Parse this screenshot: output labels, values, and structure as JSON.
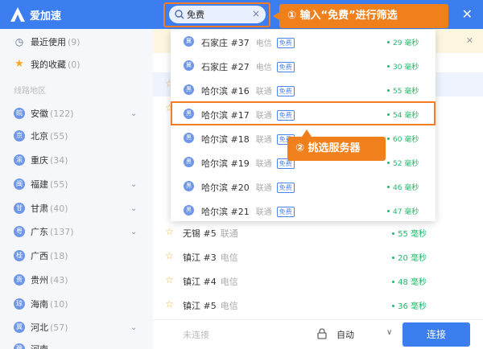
{
  "app": {
    "title": "爱加速"
  },
  "search": {
    "value": "免费",
    "clear": "×"
  },
  "window": {
    "close": "✕"
  },
  "sidebar": {
    "recent": {
      "label": "最近使用",
      "count": "(9)"
    },
    "favorites": {
      "label": "我的收藏",
      "count": "(0)"
    },
    "section_title": "线路地区",
    "regions": [
      {
        "icon": "皖",
        "label": "安徽",
        "count": "(122)",
        "expandable": true
      },
      {
        "icon": "京",
        "label": "北京",
        "count": "(55)",
        "expandable": false
      },
      {
        "icon": "渝",
        "label": "重庆",
        "count": "(34)",
        "expandable": false
      },
      {
        "icon": "闽",
        "label": "福建",
        "count": "(55)",
        "expandable": true
      },
      {
        "icon": "甘",
        "label": "甘肃",
        "count": "(40)",
        "expandable": true
      },
      {
        "icon": "粤",
        "label": "广东",
        "count": "(137)",
        "expandable": true
      },
      {
        "icon": "桂",
        "label": "广西",
        "count": "(18)",
        "expandable": false
      },
      {
        "icon": "贵",
        "label": "贵州",
        "count": "(43)",
        "expandable": false
      },
      {
        "icon": "琼",
        "label": "海南",
        "count": "(10)",
        "expandable": false
      },
      {
        "icon": "冀",
        "label": "河北",
        "count": "(57)",
        "expandable": true
      },
      {
        "icon": "豫",
        "label": "河南",
        "count": "",
        "expandable": false
      }
    ]
  },
  "notice": {
    "close": "✕"
  },
  "list_rows": [
    {
      "name": "无锡 #5",
      "isp": "联通",
      "ping": "55 毫秒"
    },
    {
      "name": "镇江 #3",
      "isp": "电信",
      "ping": "20 毫秒"
    },
    {
      "name": "镇江 #4",
      "isp": "电信",
      "ping": "48 毫秒"
    },
    {
      "name": "镇江 #5",
      "isp": "电信",
      "ping": "36 毫秒"
    }
  ],
  "dropdown": {
    "free_tag": "免费",
    "items": [
      {
        "icon": "冀",
        "name": "石家庄 #37",
        "isp": "电信",
        "ping": "29 毫秒"
      },
      {
        "icon": "冀",
        "name": "石家庄 #27",
        "isp": "电信",
        "ping": "30 毫秒"
      },
      {
        "icon": "黑",
        "name": "哈尔滨 #16",
        "isp": "联通",
        "ping": "55 毫秒"
      },
      {
        "icon": "黑",
        "name": "哈尔滨 #17",
        "isp": "联通",
        "ping": "54 毫秒"
      },
      {
        "icon": "黑",
        "name": "哈尔滨 #18",
        "isp": "联通",
        "ping": "60 毫秒"
      },
      {
        "icon": "黑",
        "name": "哈尔滨 #19",
        "isp": "联通",
        "ping": "52 毫秒"
      },
      {
        "icon": "黑",
        "name": "哈尔滨 #20",
        "isp": "联通",
        "ping": "46 毫秒"
      },
      {
        "icon": "黑",
        "name": "哈尔滨 #21",
        "isp": "联通",
        "ping": "47 毫秒"
      }
    ]
  },
  "callouts": {
    "step1": "① 输入“免费”进行筛选",
    "step2": "② 挑选服务器"
  },
  "bottom": {
    "status": "未连接",
    "mode": "自动",
    "mode_toggle": "∨",
    "connect": "连接"
  },
  "colors": {
    "brand": "#3c7ef0",
    "callout": "#f0801c",
    "ping": "#21b86b",
    "star": "#f5a623"
  }
}
